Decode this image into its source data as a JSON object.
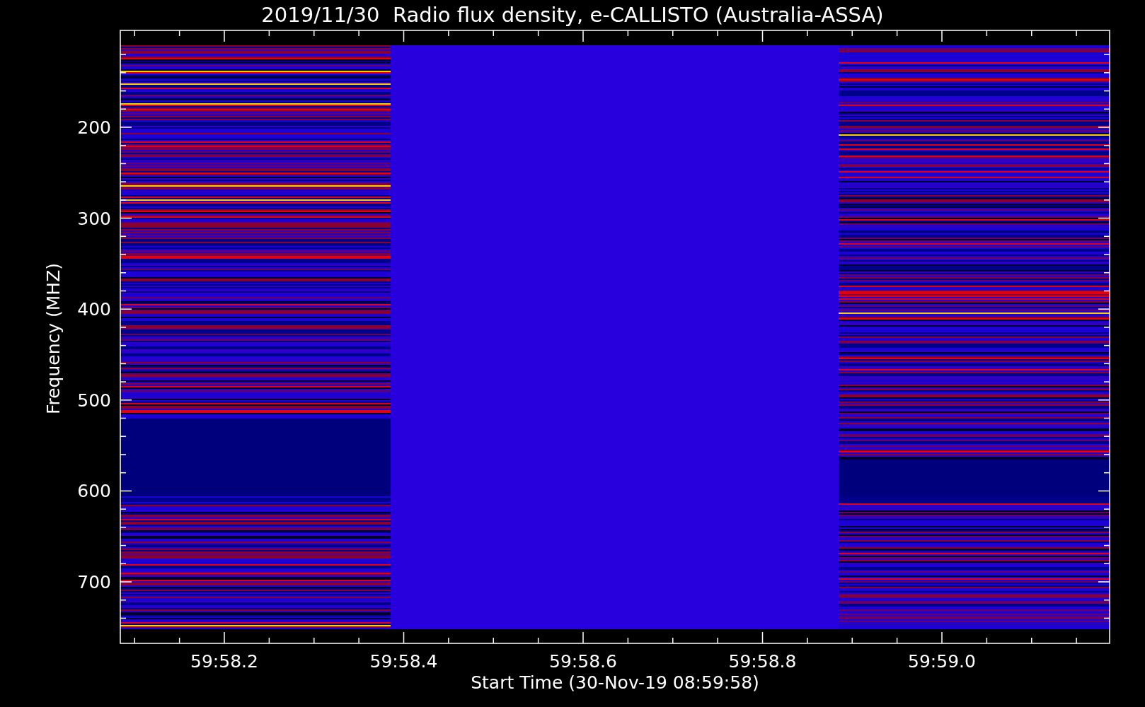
{
  "title": "2019/11/30  Radio flux density, e-CALLISTO (Australia-ASSA)",
  "y_axis": {
    "label": "Frequency (MHZ)",
    "ticks": [
      "200",
      "300",
      "400",
      "500",
      "600",
      "700"
    ]
  },
  "x_axis": {
    "label": "Start Time (30-Nov-19 08:59:58)",
    "ticks": [
      "59:58.2",
      "59:58.4",
      "59:58.6",
      "59:58.8",
      "59:59.0"
    ]
  }
}
